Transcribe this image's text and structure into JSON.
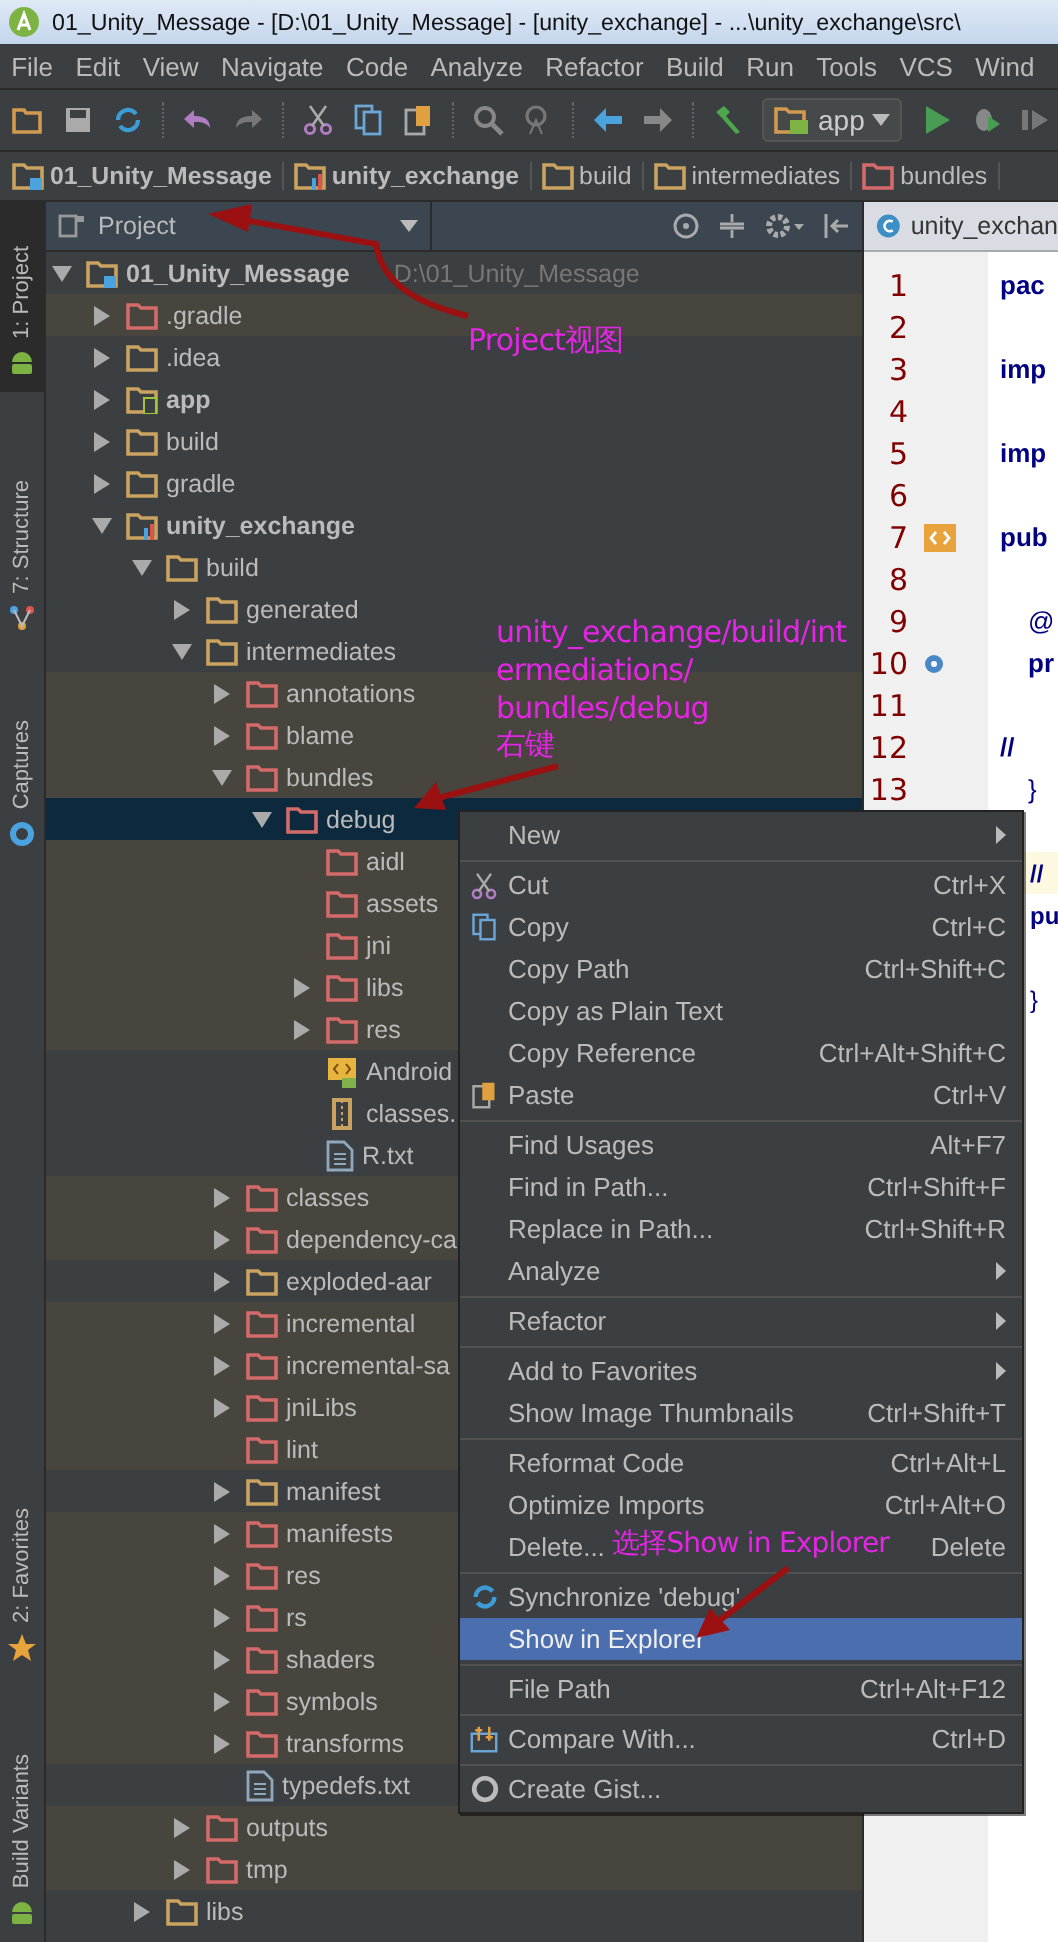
{
  "window": {
    "title": "01_Unity_Message - [D:\\01_Unity_Message] - [unity_exchange] - ...\\unity_exchange\\src\\"
  },
  "menu_bar": [
    "File",
    "Edit",
    "View",
    "Navigate",
    "Code",
    "Analyze",
    "Refactor",
    "Build",
    "Run",
    "Tools",
    "VCS",
    "Wind"
  ],
  "toolbar": {
    "run_config": "app"
  },
  "breadcrumbs": [
    {
      "label": "01_Unity_Message",
      "kind": "project"
    },
    {
      "label": "unity_exchange",
      "kind": "module"
    },
    {
      "label": "build",
      "kind": "folder"
    },
    {
      "label": "intermediates",
      "kind": "folder"
    },
    {
      "label": "bundles",
      "kind": "excluded-folder"
    }
  ],
  "tool_strip": {
    "top": [
      {
        "label": "1: Project",
        "selected": true
      },
      {
        "label": "7: Structure",
        "selected": false
      },
      {
        "label": "Captures",
        "selected": false
      }
    ],
    "bottom": [
      {
        "label": "2: Favorites",
        "selected": false
      },
      {
        "label": "Build Variants",
        "selected": false
      }
    ]
  },
  "project_panel": {
    "view": "Project",
    "tree": {
      "root": {
        "label": "01_Unity_Message",
        "hint": "D:\\01_Unity_Message",
        "kind": "project",
        "expanded": true,
        "selected": false,
        "children": [
          {
            "label": ".gradle",
            "kind": "folder",
            "excluded": true,
            "expanded": false,
            "selected": false
          },
          {
            "label": ".idea",
            "kind": "folder",
            "excluded": false,
            "expanded": false,
            "selected": false
          },
          {
            "label": "app",
            "kind": "android-module",
            "expanded": false,
            "selected": false
          },
          {
            "label": "build",
            "kind": "folder",
            "excluded": false,
            "expanded": false,
            "selected": false
          },
          {
            "label": "gradle",
            "kind": "folder",
            "excluded": false,
            "expanded": false,
            "selected": false
          },
          {
            "label": "unity_exchange",
            "kind": "module",
            "expanded": true,
            "selected": false,
            "children": [
              {
                "label": "build",
                "kind": "folder",
                "excluded": false,
                "expanded": true,
                "selected": false,
                "children": [
                  {
                    "label": "generated",
                    "kind": "folder",
                    "excluded": false,
                    "expanded": false,
                    "selected": false
                  },
                  {
                    "label": "intermediates",
                    "kind": "folder",
                    "excluded": false,
                    "expanded": true,
                    "selected": false,
                    "children": [
                      {
                        "label": "annotations",
                        "kind": "folder",
                        "excluded": true,
                        "expanded": false,
                        "selected": false
                      },
                      {
                        "label": "blame",
                        "kind": "folder",
                        "excluded": true,
                        "expanded": false,
                        "selected": false
                      },
                      {
                        "label": "bundles",
                        "kind": "folder",
                        "excluded": true,
                        "expanded": true,
                        "selected": false,
                        "children": [
                          {
                            "label": "debug",
                            "kind": "folder",
                            "excluded": true,
                            "expanded": true,
                            "selected": true,
                            "children": [
                              {
                                "label": "aidl",
                                "kind": "folder",
                                "excluded": true,
                                "selected": false
                              },
                              {
                                "label": "assets",
                                "kind": "folder",
                                "excluded": true,
                                "selected": false
                              },
                              {
                                "label": "jni",
                                "kind": "folder",
                                "excluded": true,
                                "selected": false
                              },
                              {
                                "label": "libs",
                                "kind": "folder",
                                "excluded": true,
                                "expanded": false,
                                "selected": false
                              },
                              {
                                "label": "res",
                                "kind": "folder",
                                "excluded": true,
                                "expanded": false,
                                "selected": false
                              },
                              {
                                "label": "Android",
                                "kind": "manifest-file",
                                "selected": false
                              },
                              {
                                "label": "classes.",
                                "kind": "jar-file",
                                "selected": false
                              },
                              {
                                "label": "R.txt",
                                "kind": "text-file",
                                "selected": false
                              }
                            ]
                          }
                        ]
                      },
                      {
                        "label": "classes",
                        "kind": "folder",
                        "excluded": true,
                        "expanded": false,
                        "selected": false
                      },
                      {
                        "label": "dependency-ca",
                        "kind": "folder",
                        "excluded": true,
                        "expanded": false,
                        "selected": false
                      },
                      {
                        "label": "exploded-aar",
                        "kind": "folder",
                        "excluded": false,
                        "expanded": false,
                        "selected": false
                      },
                      {
                        "label": "incremental",
                        "kind": "folder",
                        "excluded": true,
                        "expanded": false,
                        "selected": false
                      },
                      {
                        "label": "incremental-sa",
                        "kind": "folder",
                        "excluded": true,
                        "expanded": false,
                        "selected": false
                      },
                      {
                        "label": "jniLibs",
                        "kind": "folder",
                        "excluded": true,
                        "expanded": false,
                        "selected": false
                      },
                      {
                        "label": "lint",
                        "kind": "folder",
                        "excluded": true,
                        "selected": false
                      },
                      {
                        "label": "manifest",
                        "kind": "folder",
                        "excluded": false,
                        "expanded": false,
                        "selected": false
                      },
                      {
                        "label": "manifests",
                        "kind": "folder",
                        "excluded": true,
                        "expanded": false,
                        "selected": false
                      },
                      {
                        "label": "res",
                        "kind": "folder",
                        "excluded": true,
                        "expanded": false,
                        "selected": false
                      },
                      {
                        "label": "rs",
                        "kind": "folder",
                        "excluded": true,
                        "expanded": false,
                        "selected": false
                      },
                      {
                        "label": "shaders",
                        "kind": "folder",
                        "excluded": true,
                        "expanded": false,
                        "selected": false
                      },
                      {
                        "label": "symbols",
                        "kind": "folder",
                        "excluded": true,
                        "expanded": false,
                        "selected": false
                      },
                      {
                        "label": "transforms",
                        "kind": "folder",
                        "excluded": true,
                        "expanded": false,
                        "selected": false
                      },
                      {
                        "label": "typedefs.txt",
                        "kind": "text-file",
                        "selected": false
                      }
                    ]
                  },
                  {
                    "label": "outputs",
                    "kind": "folder",
                    "excluded": true,
                    "expanded": false,
                    "selected": false
                  },
                  {
                    "label": "tmp",
                    "kind": "folder",
                    "excluded": true,
                    "expanded": false,
                    "selected": false
                  }
                ]
              },
              {
                "label": "libs",
                "kind": "folder",
                "excluded": false,
                "expanded": false,
                "selected": false
              }
            ]
          }
        ]
      }
    }
  },
  "editor": {
    "tab": "unity_exchan",
    "lines": [
      {
        "number": "1",
        "text": "pac"
      },
      {
        "number": "2"
      },
      {
        "number": "3",
        "text": "imp"
      },
      {
        "number": "4"
      },
      {
        "number": "5",
        "text": "imp"
      },
      {
        "number": "6"
      },
      {
        "number": "7",
        "text": "pub"
      },
      {
        "number": "8"
      },
      {
        "number": "9",
        "text": "@"
      },
      {
        "number": "10",
        "text": "pr"
      },
      {
        "number": "11"
      },
      {
        "number": "12",
        "text": "//"
      },
      {
        "number": "13",
        "text": "}"
      }
    ],
    "code_below_menu": [
      "//",
      "pu",
      "}"
    ]
  },
  "context_menu": [
    {
      "kind": "item",
      "label": "New",
      "submenu": true,
      "selected": false
    },
    {
      "kind": "separator"
    },
    {
      "kind": "item",
      "label": "Cut",
      "shortcut": "Ctrl+X",
      "selected": false
    },
    {
      "kind": "item",
      "label": "Copy",
      "shortcut": "Ctrl+C",
      "selected": false
    },
    {
      "kind": "item",
      "label": "Copy Path",
      "shortcut": "Ctrl+Shift+C",
      "selected": false
    },
    {
      "kind": "item",
      "label": "Copy as Plain Text",
      "selected": false
    },
    {
      "kind": "item",
      "label": "Copy Reference",
      "shortcut": "Ctrl+Alt+Shift+C",
      "selected": false
    },
    {
      "kind": "item",
      "label": "Paste",
      "shortcut": "Ctrl+V",
      "selected": false
    },
    {
      "kind": "separator"
    },
    {
      "kind": "item",
      "label": "Find Usages",
      "shortcut": "Alt+F7",
      "selected": false
    },
    {
      "kind": "item",
      "label": "Find in Path...",
      "shortcut": "Ctrl+Shift+F",
      "selected": false
    },
    {
      "kind": "item",
      "label": "Replace in Path...",
      "shortcut": "Ctrl+Shift+R",
      "selected": false
    },
    {
      "kind": "item",
      "label": "Analyze",
      "submenu": true,
      "selected": false
    },
    {
      "kind": "separator"
    },
    {
      "kind": "item",
      "label": "Refactor",
      "submenu": true,
      "selected": false
    },
    {
      "kind": "separator"
    },
    {
      "kind": "item",
      "label": "Add to Favorites",
      "submenu": true,
      "selected": false
    },
    {
      "kind": "item",
      "label": "Show Image Thumbnails",
      "shortcut": "Ctrl+Shift+T",
      "selected": false
    },
    {
      "kind": "separator"
    },
    {
      "kind": "item",
      "label": "Reformat Code",
      "shortcut": "Ctrl+Alt+L",
      "selected": false
    },
    {
      "kind": "item",
      "label": "Optimize Imports",
      "shortcut": "Ctrl+Alt+O",
      "selected": false
    },
    {
      "kind": "item",
      "label": "Delete...",
      "shortcut": "Delete",
      "selected": false
    },
    {
      "kind": "separator"
    },
    {
      "kind": "item",
      "label": "Synchronize 'debug'",
      "selected": false
    },
    {
      "kind": "item",
      "label": "Show in Explorer",
      "selected": true
    },
    {
      "kind": "separator"
    },
    {
      "kind": "item",
      "label": "File Path",
      "shortcut": "Ctrl+Alt+F12",
      "selected": false
    },
    {
      "kind": "separator"
    },
    {
      "kind": "item",
      "label": "Compare With...",
      "shortcut": "Ctrl+D",
      "selected": false
    },
    {
      "kind": "separator"
    },
    {
      "kind": "item",
      "label": "Create Gist...",
      "selected": false
    }
  ],
  "annotations": [
    "Project视图",
    "unity_exchange/build/intermediations/",
    "bundles/debug",
    "右键",
    "选择Show in Explorer"
  ]
}
